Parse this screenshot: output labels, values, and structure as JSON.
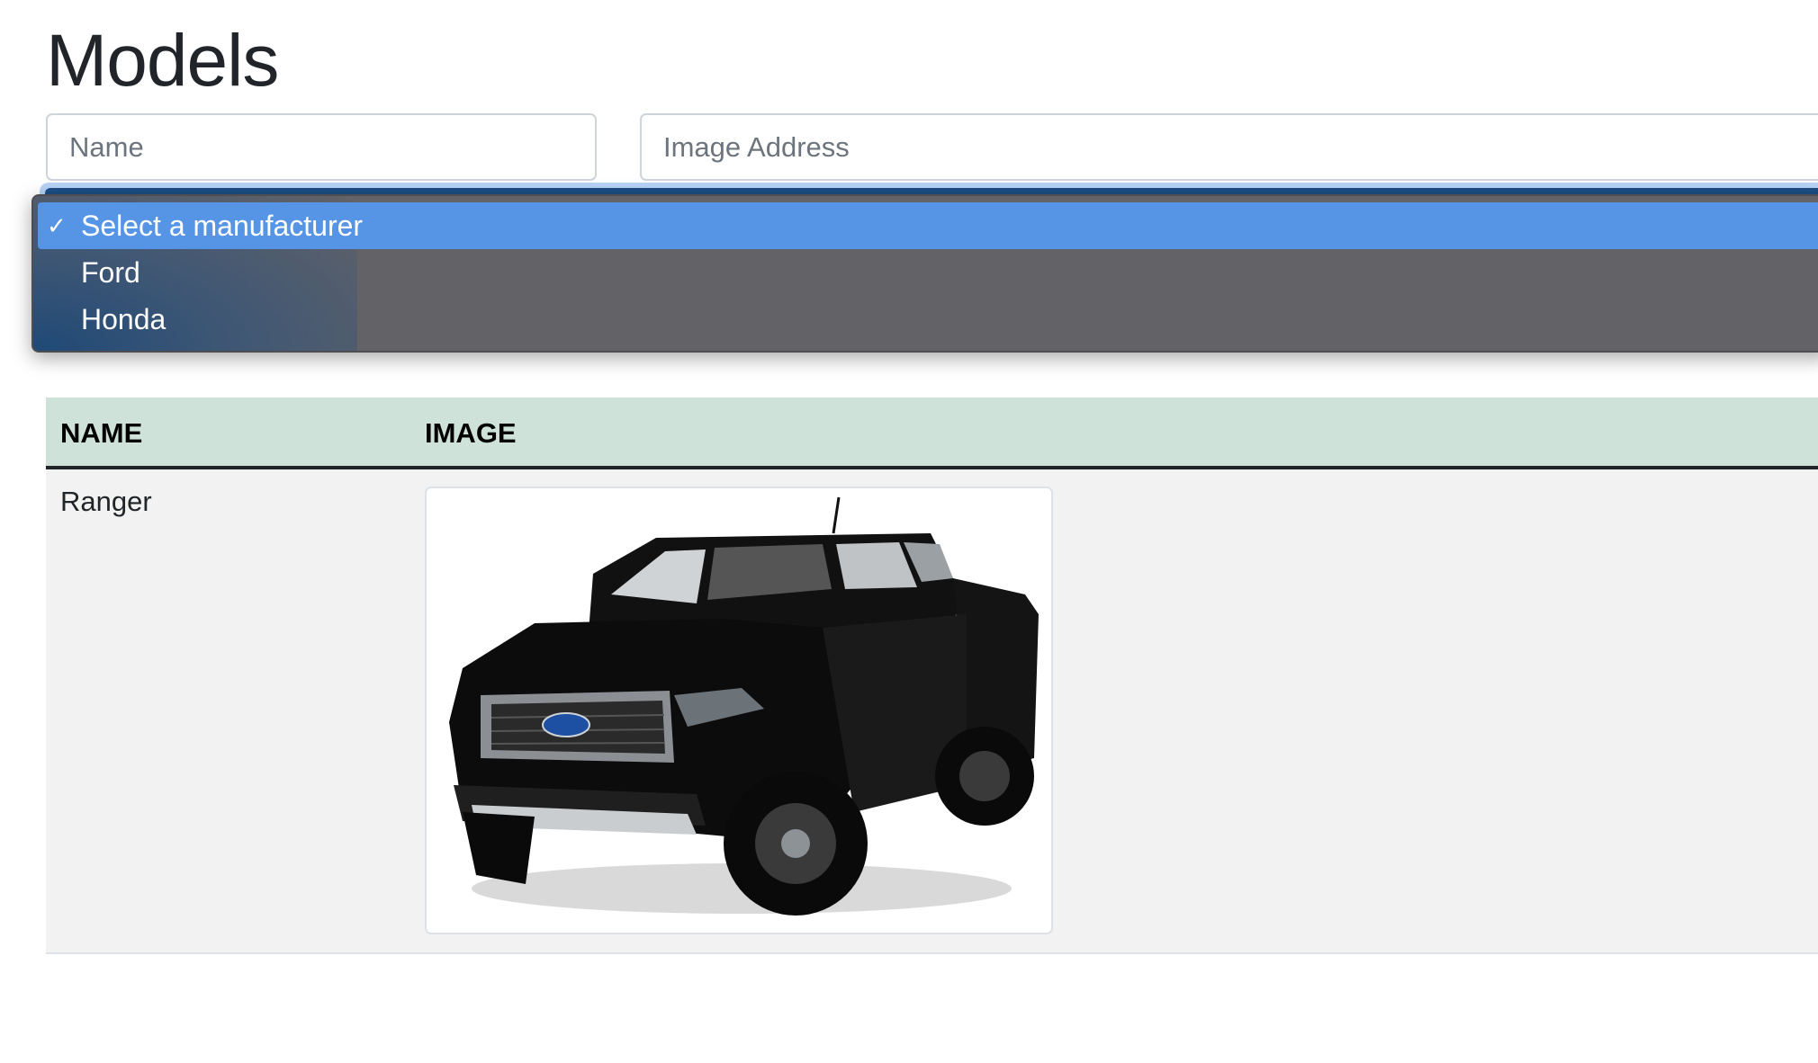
{
  "page": {
    "title": "Models"
  },
  "form": {
    "name_placeholder": "Name",
    "image_placeholder": "Image Address",
    "manufacturer_select": {
      "selected": "Select a manufacturer",
      "options": [
        {
          "label": "Select a manufacturer",
          "selected": true
        },
        {
          "label": "Ford",
          "selected": false
        },
        {
          "label": "Honda",
          "selected": false
        }
      ]
    }
  },
  "table": {
    "headers": [
      "Name",
      "Image"
    ],
    "rows": [
      {
        "name": "Ranger",
        "image_alt": "Ford Ranger"
      }
    ]
  },
  "colors": {
    "header_bg": "#cfe2d9",
    "selected_option": "#5694e5",
    "dropdown_bg": "#636267"
  }
}
